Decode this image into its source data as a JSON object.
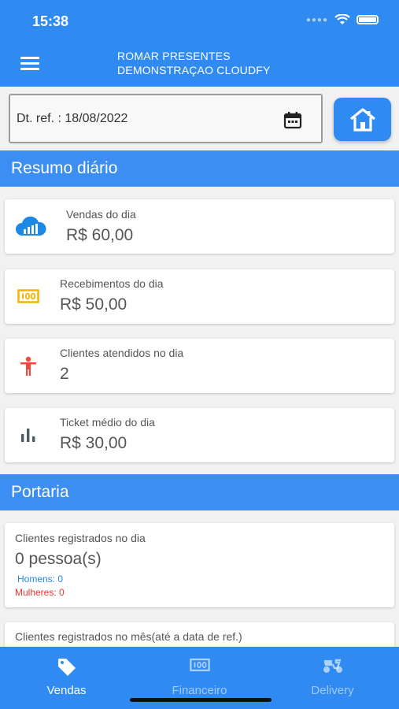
{
  "status": {
    "time": "15:38"
  },
  "header": {
    "line1": "ROMAR PRESENTES",
    "line2": "DEMONSTRAÇAO CLOUDFY"
  },
  "date_field": {
    "text": "Dt. ref. : 18/08/2022"
  },
  "sections": {
    "resumo": "Resumo diário",
    "portaria": "Portaria"
  },
  "cards": [
    {
      "label": "Vendas do dia",
      "value": "R$ 60,00"
    },
    {
      "label": "Recebimentos do dia",
      "value": "R$ 50,00"
    },
    {
      "label": "Clientes atendidos no dia",
      "value": "2"
    },
    {
      "label": "Ticket médio do dia",
      "value": "R$ 30,00"
    }
  ],
  "portaria": {
    "day_label": "Clientes registrados no dia",
    "day_value": "0 pessoa(s)",
    "men": "Homens: 0",
    "women": "Mulheres: 0",
    "month_label": "Clientes registrados no mês(até a data de ref.)"
  },
  "tabs": [
    {
      "label": "Vendas",
      "active": true
    },
    {
      "label": "Financeiro",
      "active": false
    },
    {
      "label": "Delivery",
      "active": false
    }
  ],
  "colors": {
    "primary": "#2f8af2",
    "cloud_icon": "#1e88e5",
    "money_icon": "#f4b400",
    "person_icon": "#ef4a3c",
    "chart_icon": "#4a5a68",
    "men_text": "#1e88e5",
    "women_text": "#e53935"
  },
  "icons": {
    "card_0": "cloud-chart-icon",
    "card_1": "money-icon",
    "card_2": "person-icon",
    "card_3": "bar-chart-icon"
  }
}
